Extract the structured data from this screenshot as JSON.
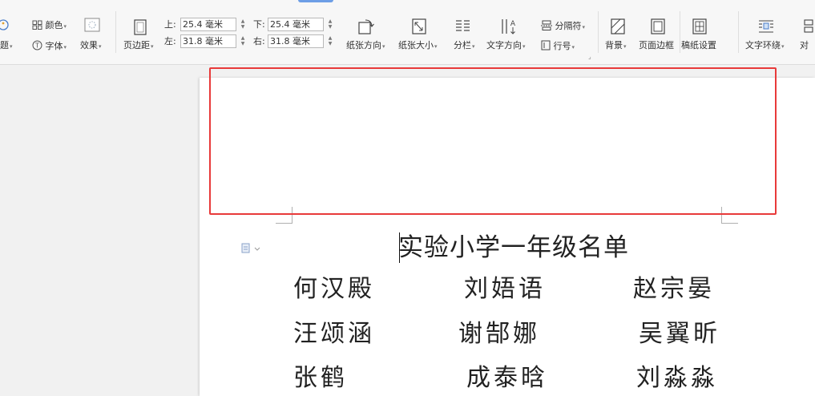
{
  "ribbon": {
    "row1": {
      "colors_label": "颜色",
      "margin_top_label": "上:",
      "margin_top_value": "25.4 毫米",
      "margin_bottom_label": "下:",
      "margin_bottom_value": "25.4 毫米",
      "separator_label": "分隔符"
    },
    "row2": {
      "theme_label": "题",
      "fonts_label": "字体",
      "effects_label": "效果",
      "margins_label": "页边距",
      "margin_left_label": "左:",
      "margin_left_value": "31.8 毫米",
      "margin_right_label": "右:",
      "margin_right_value": "31.8 毫米",
      "orientation_label": "纸张方向",
      "size_label": "纸张大小",
      "columns_label": "分栏",
      "text_direction_label": "文字方向",
      "line_numbers_label": "行号",
      "background_label": "背景",
      "page_border_label": "页面边框",
      "manuscript_label": "稿纸设置",
      "text_wrap_label": "文字环绕",
      "align_label": "对"
    }
  },
  "document": {
    "title": "实验小学一年级名单",
    "names": [
      [
        "何汉殿",
        "刘娪语",
        "赵宗晏"
      ],
      [
        "汪颂涵",
        "谢郜娜",
        "吴翼昕"
      ],
      [
        "张鹤",
        "成泰晗",
        "刘淼淼"
      ]
    ]
  },
  "colors": {
    "highlight": "#e83a3a",
    "ribbon_bg": "#f7f7f7",
    "workspace_bg": "#f1f1f1",
    "page_bg": "#ffffff"
  }
}
